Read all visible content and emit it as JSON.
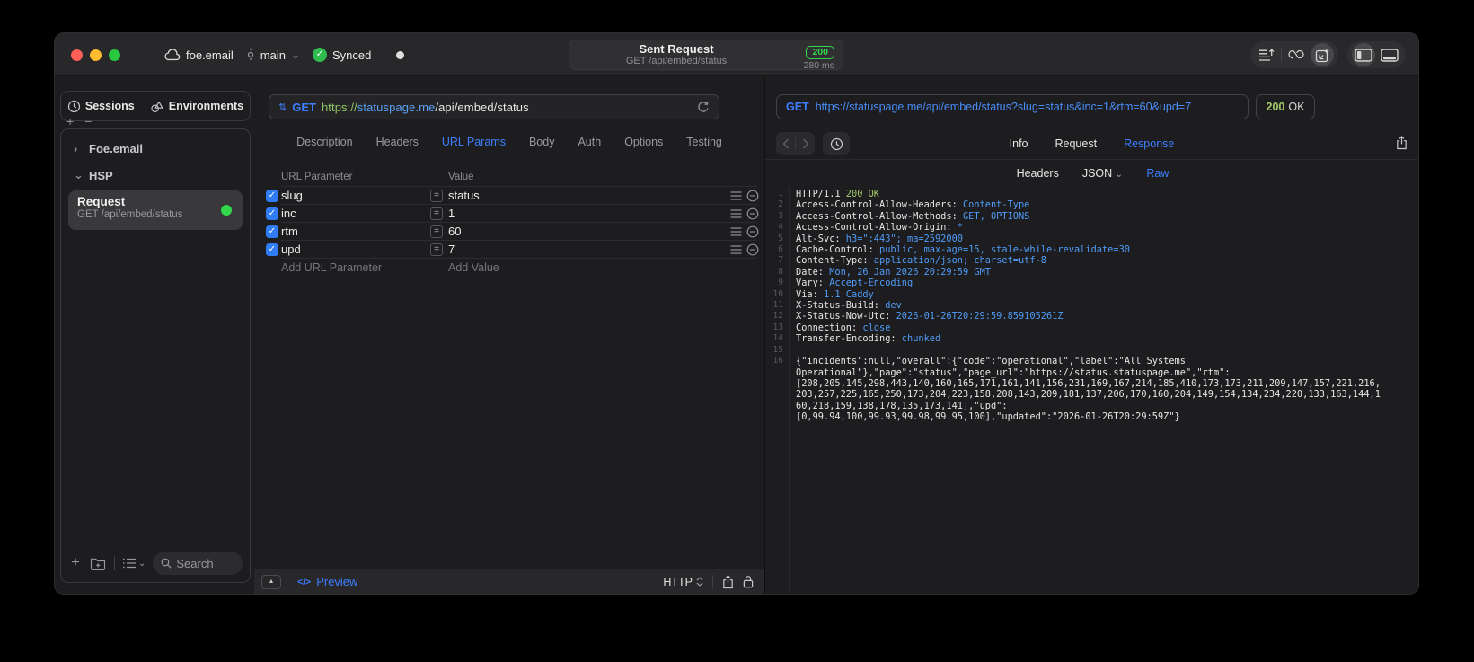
{
  "titlebar": {
    "project_name": "foe.email",
    "branch_name": "main",
    "sync_label": "Synced",
    "request_summary": {
      "title": "Sent Request",
      "subtitle": "GET /api/embed/status",
      "status_code": "200",
      "duration": "280 ms"
    }
  },
  "sidebar": {
    "tabs": [
      "Sessions",
      "Environments"
    ],
    "tree_groups": [
      "Foe.email",
      "HSP"
    ],
    "request_item": {
      "title": "Request",
      "subtitle": "GET /api/embed/status"
    },
    "search_placeholder": "Search"
  },
  "request_editor": {
    "method": "GET",
    "url_scheme": "https://",
    "url_host": "statuspage.me",
    "url_path": "/api/embed/status",
    "tabs": [
      "Description",
      "Headers",
      "URL Params",
      "Body",
      "Auth",
      "Options",
      "Testing"
    ],
    "active_tab": "URL Params",
    "params_table": {
      "columns": [
        "URL Parameter",
        "Value"
      ],
      "rows": [
        {
          "name": "slug",
          "value": "status",
          "enabled": true
        },
        {
          "name": "inc",
          "value": "1",
          "enabled": true
        },
        {
          "name": "rtm",
          "value": "60",
          "enabled": true
        },
        {
          "name": "upd",
          "value": "7",
          "enabled": true
        }
      ],
      "add_name_placeholder": "Add URL Parameter",
      "add_value_placeholder": "Add Value"
    },
    "footer": {
      "code_glyph": "</>",
      "preview_label": "Preview",
      "protocol_label": "HTTP"
    }
  },
  "response_viewer": {
    "method": "GET",
    "url": "https://statuspage.me/api/embed/status?slug=status&inc=1&rtm=60&upd=7",
    "status_code": "200",
    "status_text": "OK",
    "tabs": [
      "Info",
      "Request",
      "Response"
    ],
    "active_tab": "Response",
    "subtabs": [
      "Headers",
      "JSON",
      "Raw"
    ],
    "active_subtab": "Raw",
    "body_lines": [
      {
        "num": "1",
        "segs": [
          [
            "HTTP/1.1 ",
            "w"
          ],
          [
            "200 OK",
            "g"
          ]
        ]
      },
      {
        "num": "2",
        "segs": [
          [
            "Access-Control-Allow-Headers: ",
            "w"
          ],
          [
            "Content-Type",
            "b"
          ]
        ]
      },
      {
        "num": "3",
        "segs": [
          [
            "Access-Control-Allow-Methods: ",
            "w"
          ],
          [
            "GET, OPTIONS",
            "b"
          ]
        ]
      },
      {
        "num": "4",
        "segs": [
          [
            "Access-Control-Allow-Origin: ",
            "w"
          ],
          [
            "*",
            "b"
          ]
        ]
      },
      {
        "num": "5",
        "segs": [
          [
            "Alt-Svc: ",
            "w"
          ],
          [
            "h3=\":443\"; ma=2592000",
            "b"
          ]
        ]
      },
      {
        "num": "6",
        "segs": [
          [
            "Cache-Control: ",
            "w"
          ],
          [
            "public, max-age=15, stale-while-revalidate=30",
            "b"
          ]
        ]
      },
      {
        "num": "7",
        "segs": [
          [
            "Content-Type: ",
            "w"
          ],
          [
            "application/json; charset=utf-8",
            "b"
          ]
        ]
      },
      {
        "num": "8",
        "segs": [
          [
            "Date: ",
            "w"
          ],
          [
            "Mon, 26 Jan 2026 20:29:59 GMT",
            "b"
          ]
        ]
      },
      {
        "num": "9",
        "segs": [
          [
            "Vary: ",
            "w"
          ],
          [
            "Accept-Encoding",
            "b"
          ]
        ]
      },
      {
        "num": "10",
        "segs": [
          [
            "Via: ",
            "w"
          ],
          [
            "1.1 Caddy",
            "b"
          ]
        ]
      },
      {
        "num": "11",
        "segs": [
          [
            "X-Status-Build: ",
            "w"
          ],
          [
            "dev",
            "b"
          ]
        ]
      },
      {
        "num": "12",
        "segs": [
          [
            "X-Status-Now-Utc: ",
            "w"
          ],
          [
            "2026-01-26T20:29:59.859105261Z",
            "b"
          ]
        ]
      },
      {
        "num": "13",
        "segs": [
          [
            "Connection: ",
            "w"
          ],
          [
            "close",
            "b"
          ]
        ]
      },
      {
        "num": "14",
        "segs": [
          [
            "Transfer-Encoding: ",
            "w"
          ],
          [
            "chunked",
            "b"
          ]
        ]
      },
      {
        "num": "15",
        "segs": []
      },
      {
        "num": "16",
        "segs": [
          [
            "{\"incidents\":null,\"overall\":{\"code\":\"operational\",\"label\":\"All Systems",
            "w"
          ]
        ]
      },
      {
        "num": "",
        "segs": [
          [
            "Operational\"},\"page\":\"status\",\"page_url\":\"https://status.statuspage.me\",\"rtm\":",
            "w"
          ]
        ]
      },
      {
        "num": "",
        "segs": [
          [
            "[208,205,145,298,443,140,160,165,171,161,141,156,231,169,167,214,185,410,173,173,211,209,147,157,221,216,",
            "w"
          ]
        ]
      },
      {
        "num": "",
        "segs": [
          [
            "203,257,225,165,250,173,204,223,158,208,143,209,181,137,206,170,160,204,149,154,134,234,220,133,163,144,1",
            "w"
          ]
        ]
      },
      {
        "num": "",
        "segs": [
          [
            "60,218,159,138,178,135,173,141],\"upd\":",
            "w"
          ]
        ]
      },
      {
        "num": "",
        "segs": [
          [
            "[0,99.94,100,99.93,99.98,99.95,100],\"updated\":\"2026-01-26T20:29:59Z\"}",
            "w"
          ]
        ]
      }
    ]
  },
  "colors": {
    "accent_blue": "#3d7eff",
    "badge_green": "#32d74b",
    "url_scheme_green": "#8fc768",
    "url_host_blue": "#5ba0f5",
    "code_value_blue": "#4f9cf9",
    "code_status_green": "#a3c96a"
  }
}
